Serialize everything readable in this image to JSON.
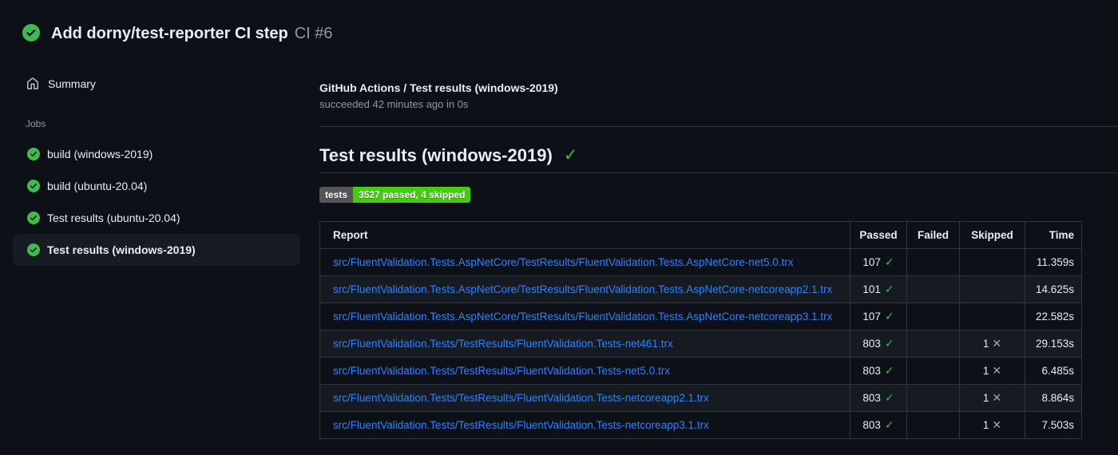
{
  "header": {
    "title": "Add dorny/test-reporter CI step",
    "run_number": "CI #6"
  },
  "sidebar": {
    "summary_label": "Summary",
    "jobs_label": "Jobs",
    "jobs": [
      {
        "label": "build (windows-2019)",
        "selected": false
      },
      {
        "label": "build (ubuntu-20.04)",
        "selected": false
      },
      {
        "label": "Test results (ubuntu-20.04)",
        "selected": false
      },
      {
        "label": "Test results (windows-2019)",
        "selected": true
      }
    ]
  },
  "main": {
    "check_title": "GitHub Actions / Test results (windows-2019)",
    "check_status": "succeeded 42 minutes ago in 0s",
    "section_heading": "Test results (windows-2019)",
    "heading_check": "✓",
    "badge": {
      "label": "tests",
      "value": "3527 passed, 4 skipped",
      "label_bg": "#555555",
      "value_bg": "#44cc11"
    },
    "table": {
      "columns": [
        "Report",
        "Passed",
        "Failed",
        "Skipped",
        "Time"
      ],
      "passed_icon": "✓",
      "skipped_icon": "✕",
      "rows": [
        {
          "report": "src/FluentValidation.Tests.AspNetCore/TestResults/FluentValidation.Tests.AspNetCore-net5.0.trx",
          "passed": "107",
          "failed": "",
          "skipped": "",
          "time": "11.359s"
        },
        {
          "report": "src/FluentValidation.Tests.AspNetCore/TestResults/FluentValidation.Tests.AspNetCore-netcoreapp2.1.trx",
          "passed": "101",
          "failed": "",
          "skipped": "",
          "time": "14.625s"
        },
        {
          "report": "src/FluentValidation.Tests.AspNetCore/TestResults/FluentValidation.Tests.AspNetCore-netcoreapp3.1.trx",
          "passed": "107",
          "failed": "",
          "skipped": "",
          "time": "22.582s"
        },
        {
          "report": "src/FluentValidation.Tests/TestResults/FluentValidation.Tests-net461.trx",
          "passed": "803",
          "failed": "",
          "skipped": "1",
          "time": "29.153s"
        },
        {
          "report": "src/FluentValidation.Tests/TestResults/FluentValidation.Tests-net5.0.trx",
          "passed": "803",
          "failed": "",
          "skipped": "1",
          "time": "6.485s"
        },
        {
          "report": "src/FluentValidation.Tests/TestResults/FluentValidation.Tests-netcoreapp2.1.trx",
          "passed": "803",
          "failed": "",
          "skipped": "1",
          "time": "8.864s"
        },
        {
          "report": "src/FluentValidation.Tests/TestResults/FluentValidation.Tests-netcoreapp3.1.trx",
          "passed": "803",
          "failed": "",
          "skipped": "1",
          "time": "7.503s"
        }
      ]
    }
  },
  "colors": {
    "background": "#0d1117",
    "accent_green": "#3fb950",
    "link_blue": "#2f81f7",
    "border": "#30363d",
    "row_alt": "#161b22",
    "selected_item_bg": "#171c24",
    "text_secondary": "#9198a1"
  }
}
